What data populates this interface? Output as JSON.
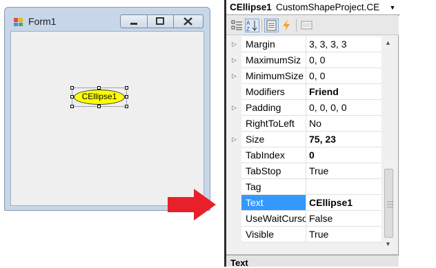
{
  "form": {
    "title": "Form1",
    "control_text": "CEllipse1",
    "control_fill": "#ffff00"
  },
  "properties_panel": {
    "object_name": "CEllipse1",
    "object_type": "CustomShapeProject.CE",
    "toolbar_icons": [
      "categorized-icon",
      "alphabetical-icon",
      "properties-icon",
      "events-icon",
      "property-pages-icon"
    ],
    "rows": [
      {
        "name": "Margin",
        "value": "3, 3, 3, 3",
        "expandable": true,
        "bold": false
      },
      {
        "name": "MaximumSiz",
        "value": "0, 0",
        "expandable": true,
        "bold": false
      },
      {
        "name": "MinimumSize",
        "value": "0, 0",
        "expandable": true,
        "bold": false
      },
      {
        "name": "Modifiers",
        "value": "Friend",
        "expandable": false,
        "bold": true
      },
      {
        "name": "Padding",
        "value": "0, 0, 0, 0",
        "expandable": true,
        "bold": false
      },
      {
        "name": "RightToLeft",
        "value": "No",
        "expandable": false,
        "bold": false
      },
      {
        "name": "Size",
        "value": "75, 23",
        "expandable": true,
        "bold": true
      },
      {
        "name": "TabIndex",
        "value": "0",
        "expandable": false,
        "bold": true
      },
      {
        "name": "TabStop",
        "value": "True",
        "expandable": false,
        "bold": false
      },
      {
        "name": "Tag",
        "value": "",
        "expandable": false,
        "bold": false
      },
      {
        "name": "Text",
        "value": "CEllipse1",
        "expandable": false,
        "bold": true,
        "selected": true
      },
      {
        "name": "UseWaitCurso",
        "value": "False",
        "expandable": false,
        "bold": false
      },
      {
        "name": "Visible",
        "value": "True",
        "expandable": false,
        "bold": false
      }
    ],
    "description_title": "Text"
  },
  "colors": {
    "selection": "#3399ff",
    "arrow": "#e8202a"
  }
}
